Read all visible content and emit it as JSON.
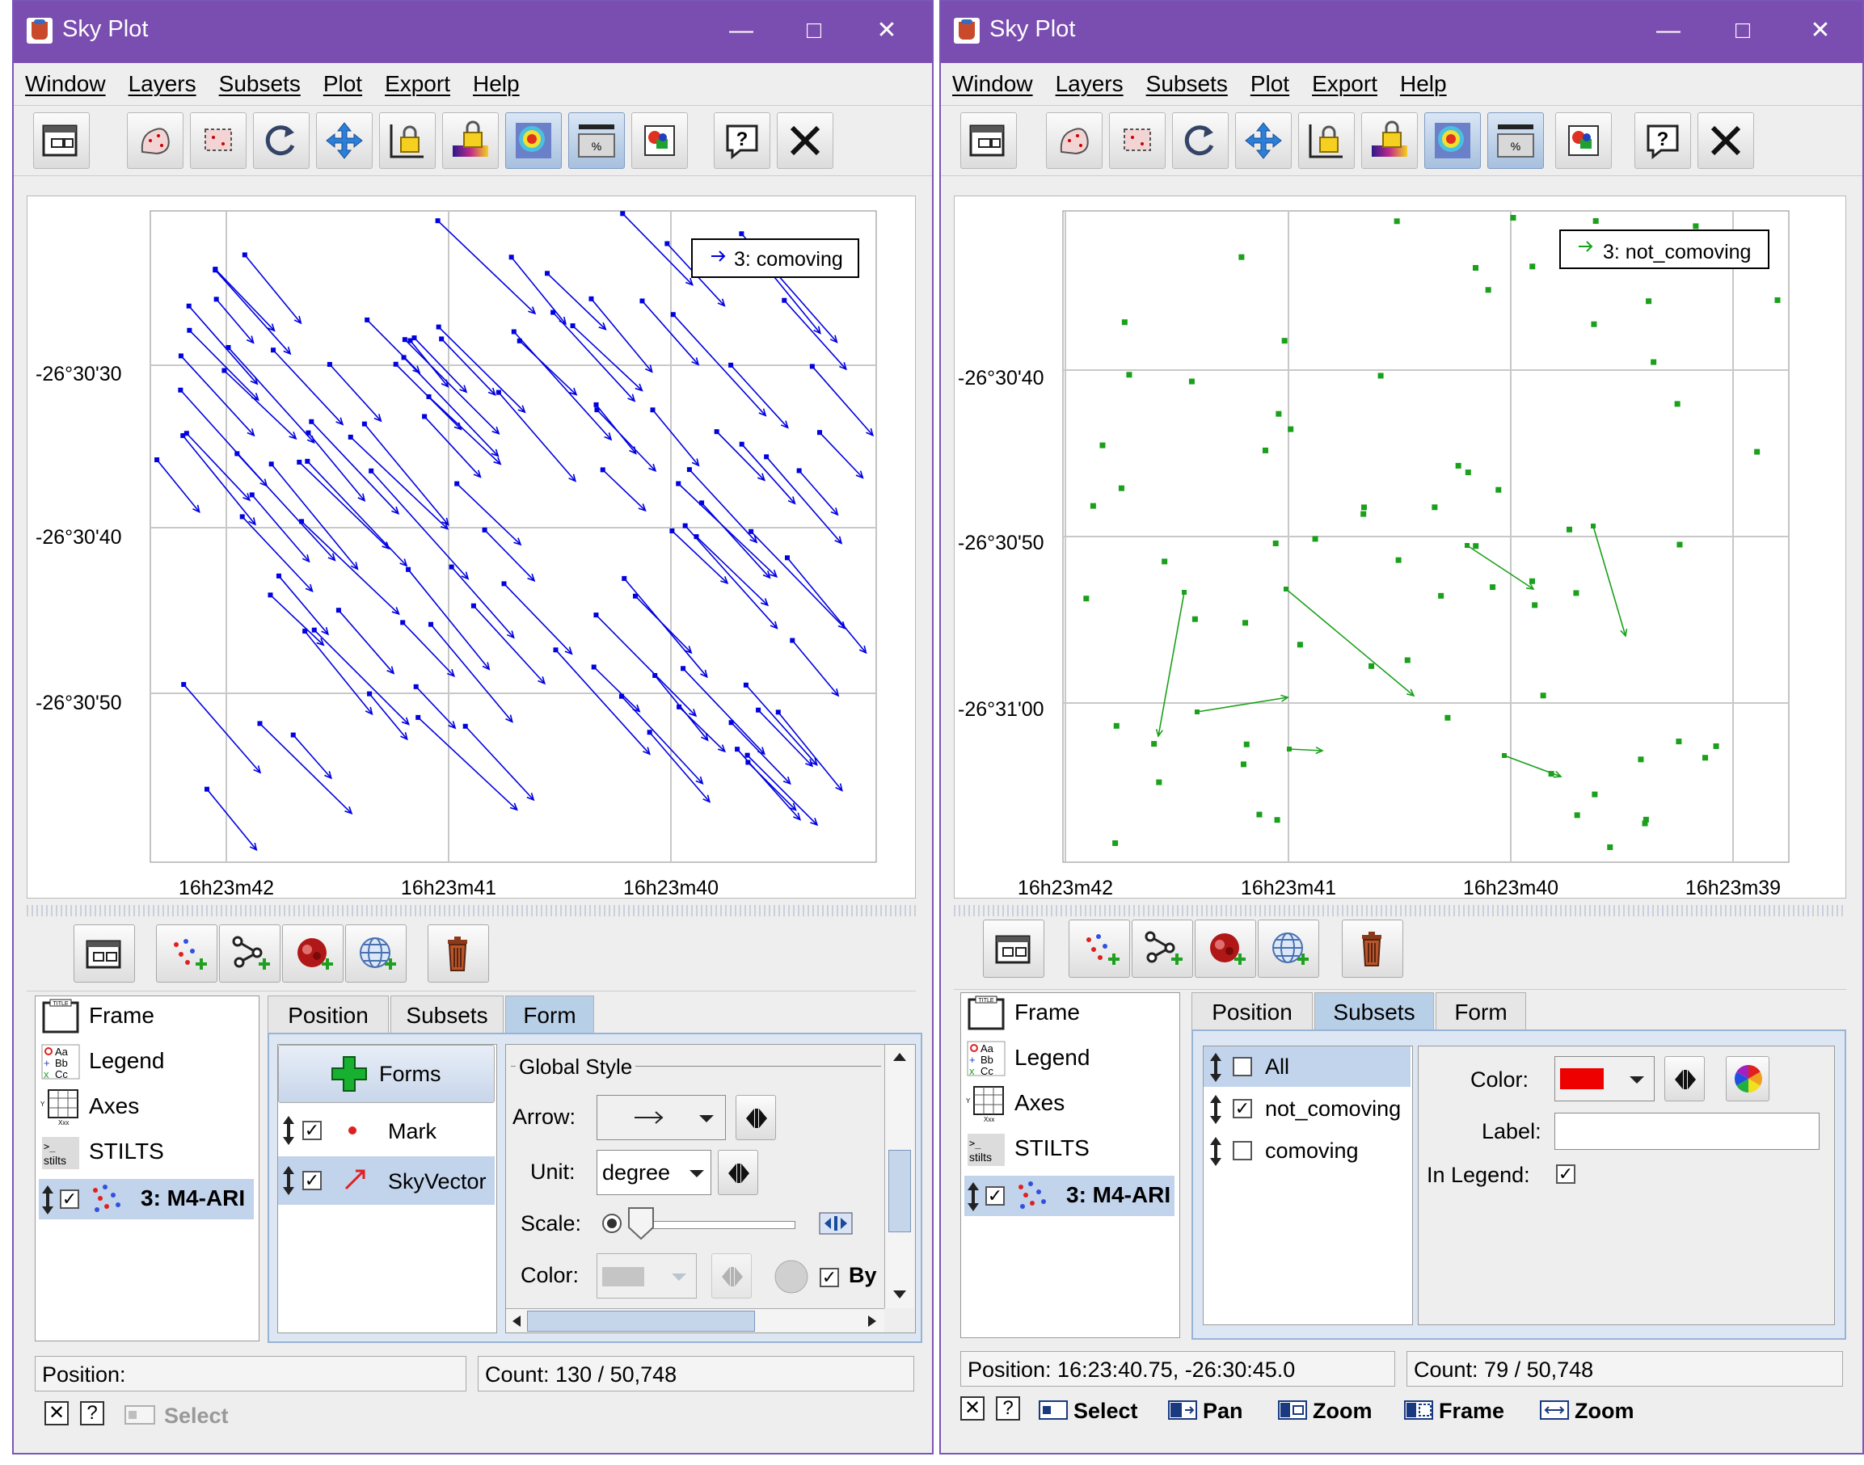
{
  "left": {
    "title": "Sky Plot",
    "menus": [
      "Window",
      "Layers",
      "Subsets",
      "Plot",
      "Export",
      "Help"
    ],
    "legend_label": "3: comoving",
    "y_ticks": [
      "-26°30'30",
      "-26°30'40",
      "-26°30'50"
    ],
    "x_ticks": [
      "16h23m42",
      "16h23m41",
      "16h23m40"
    ],
    "controls": [
      "Frame",
      "Legend",
      "Axes",
      "STILTS",
      "3: M4-ARI"
    ],
    "tabs": [
      "Position",
      "Subsets",
      "Form"
    ],
    "forms_button": "Forms",
    "forms": [
      "Mark",
      "SkyVector"
    ],
    "global_style": "Global Style",
    "arrow_label": "Arrow:",
    "unit_label": "Unit:",
    "unit_value": "degree",
    "scale_label": "Scale:",
    "color_label": "Color:",
    "by_label": "By",
    "position_label": "Position:",
    "count_label": "Count: 130 / 50,748",
    "select_label": "Select",
    "color": "#0000e0"
  },
  "right": {
    "title": "Sky Plot",
    "menus": [
      "Window",
      "Layers",
      "Subsets",
      "Plot",
      "Export",
      "Help"
    ],
    "legend_label": "3: not_comoving",
    "y_ticks": [
      "-26°30'40",
      "-26°30'50",
      "-26°31'00"
    ],
    "x_ticks": [
      "16h23m42",
      "16h23m41",
      "16h23m40",
      "16h23m39"
    ],
    "controls": [
      "Frame",
      "Legend",
      "Axes",
      "STILTS",
      "3: M4-ARI"
    ],
    "tabs": [
      "Position",
      "Subsets",
      "Form"
    ],
    "subsets": [
      "All",
      "not_comoving",
      "comoving"
    ],
    "color_label": "Color:",
    "label_label": "Label:",
    "in_legend_label": "In Legend:",
    "position_label": "Position: 16:23:40.75, -26:30:45.0",
    "count_label": "Count: 79 / 50,748",
    "modes": [
      "Select",
      "Pan",
      "Zoom",
      "Frame",
      "Zoom"
    ],
    "color": "#1aa01a",
    "swatch_color": "#ee0000"
  }
}
